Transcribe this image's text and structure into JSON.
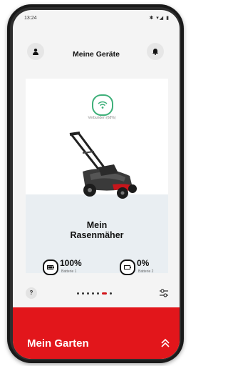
{
  "status": {
    "time": "13:24",
    "icons": "✱ ▾◢ ▮"
  },
  "header": {
    "title": "Meine Geräte"
  },
  "device": {
    "connection": "Verbunden (68%)",
    "name_line1": "Mein",
    "name_line2": "Rasenmäher",
    "battery1": {
      "value": "100%",
      "label": "Batterie 1",
      "level": 1.0
    },
    "battery2": {
      "value": "0%",
      "label": "Batterie 2",
      "level": 0.0
    }
  },
  "pager": {
    "count": 7,
    "active_index": 5
  },
  "help": "?",
  "footer": {
    "title": "Mein Garten"
  },
  "colors": {
    "accent": "#e2161b",
    "wifi": "#3fb07a",
    "card_bottom": "#e9eef2"
  },
  "icons": {
    "profile": "user-icon",
    "notifications": "bell-icon",
    "wifi": "wifi-icon",
    "settings": "sliders-icon",
    "expand": "double-chevron-up-icon"
  }
}
